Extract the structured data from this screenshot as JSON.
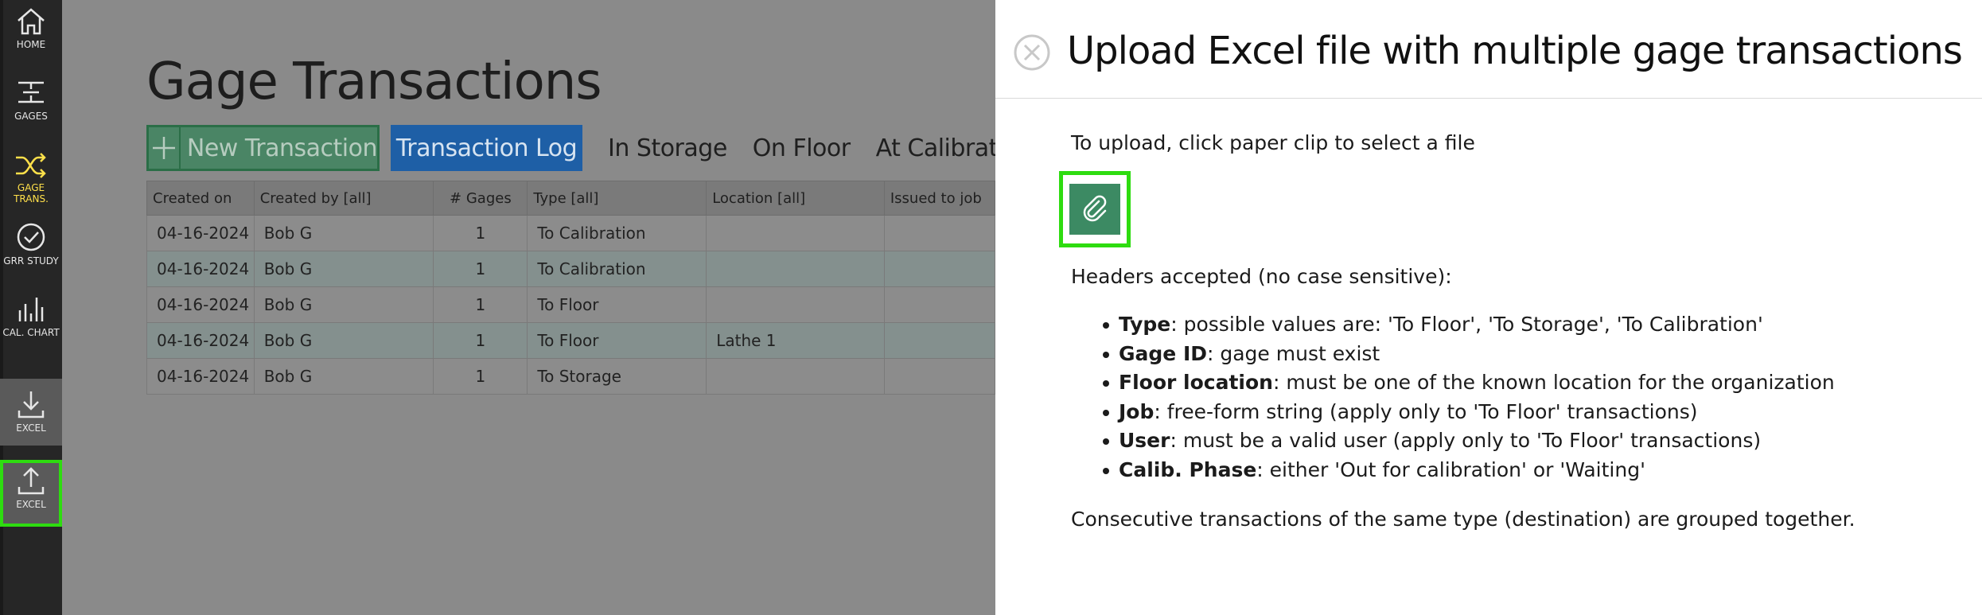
{
  "sidebar": {
    "items": [
      {
        "label": "HOME"
      },
      {
        "label": "GAGES"
      },
      {
        "label_line1": "GAGE",
        "label_line2": "TRANS."
      },
      {
        "label": "GRR STUDY"
      },
      {
        "label": "CAL. CHART"
      },
      {
        "label": "EXCEL"
      },
      {
        "label": "EXCEL"
      }
    ],
    "active_color": "#ffe04a",
    "highlight_color": "#2edc10"
  },
  "main": {
    "title": "Gage Transactions",
    "new_transaction_label": "New Transaction",
    "tabs": [
      {
        "label": "Transaction Log"
      },
      {
        "label": "In Storage"
      },
      {
        "label": "On Floor"
      },
      {
        "label": "At Calibrat"
      }
    ],
    "table": {
      "headers": [
        "Created on",
        "Created by [all]",
        "# Gages",
        "Type [all]",
        "Location [all]",
        "Issued to job"
      ],
      "rows": [
        [
          "04-16-2024",
          "Bob G",
          "1",
          "To Calibration",
          "",
          ""
        ],
        [
          "04-16-2024",
          "Bob G",
          "1",
          "To Calibration",
          "",
          ""
        ],
        [
          "04-16-2024",
          "Bob G",
          "1",
          "To Floor",
          "",
          ""
        ],
        [
          "04-16-2024",
          "Bob G",
          "1",
          "To Floor",
          "Lathe 1",
          ""
        ],
        [
          "04-16-2024",
          "Bob G",
          "1",
          "To Storage",
          "",
          ""
        ]
      ]
    }
  },
  "panel": {
    "title": "Upload Excel file with multiple gage transactions",
    "instruction": "To upload, click paper clip to select a file",
    "headers_label": "Headers accepted (no case sensitive):",
    "rules": [
      {
        "key": "Type",
        "desc": ": possible values are: 'To Floor', 'To Storage', 'To Calibration'"
      },
      {
        "key": "Gage ID",
        "desc": ": gage must exist"
      },
      {
        "key": "Floor location",
        "desc": ": must be one of the known location for the organization"
      },
      {
        "key": "Job",
        "desc": ": free-form string (apply only to 'To Floor' transactions)"
      },
      {
        "key": "User",
        "desc": ": must be a valid user (apply only to 'To Floor' transactions)"
      },
      {
        "key": "Calib. Phase",
        "desc": ": either 'Out for calibration' or 'Waiting'"
      }
    ],
    "footer": "Consecutive transactions of the same type (destination) are grouped together.",
    "clip_color": "#3c8a63"
  }
}
